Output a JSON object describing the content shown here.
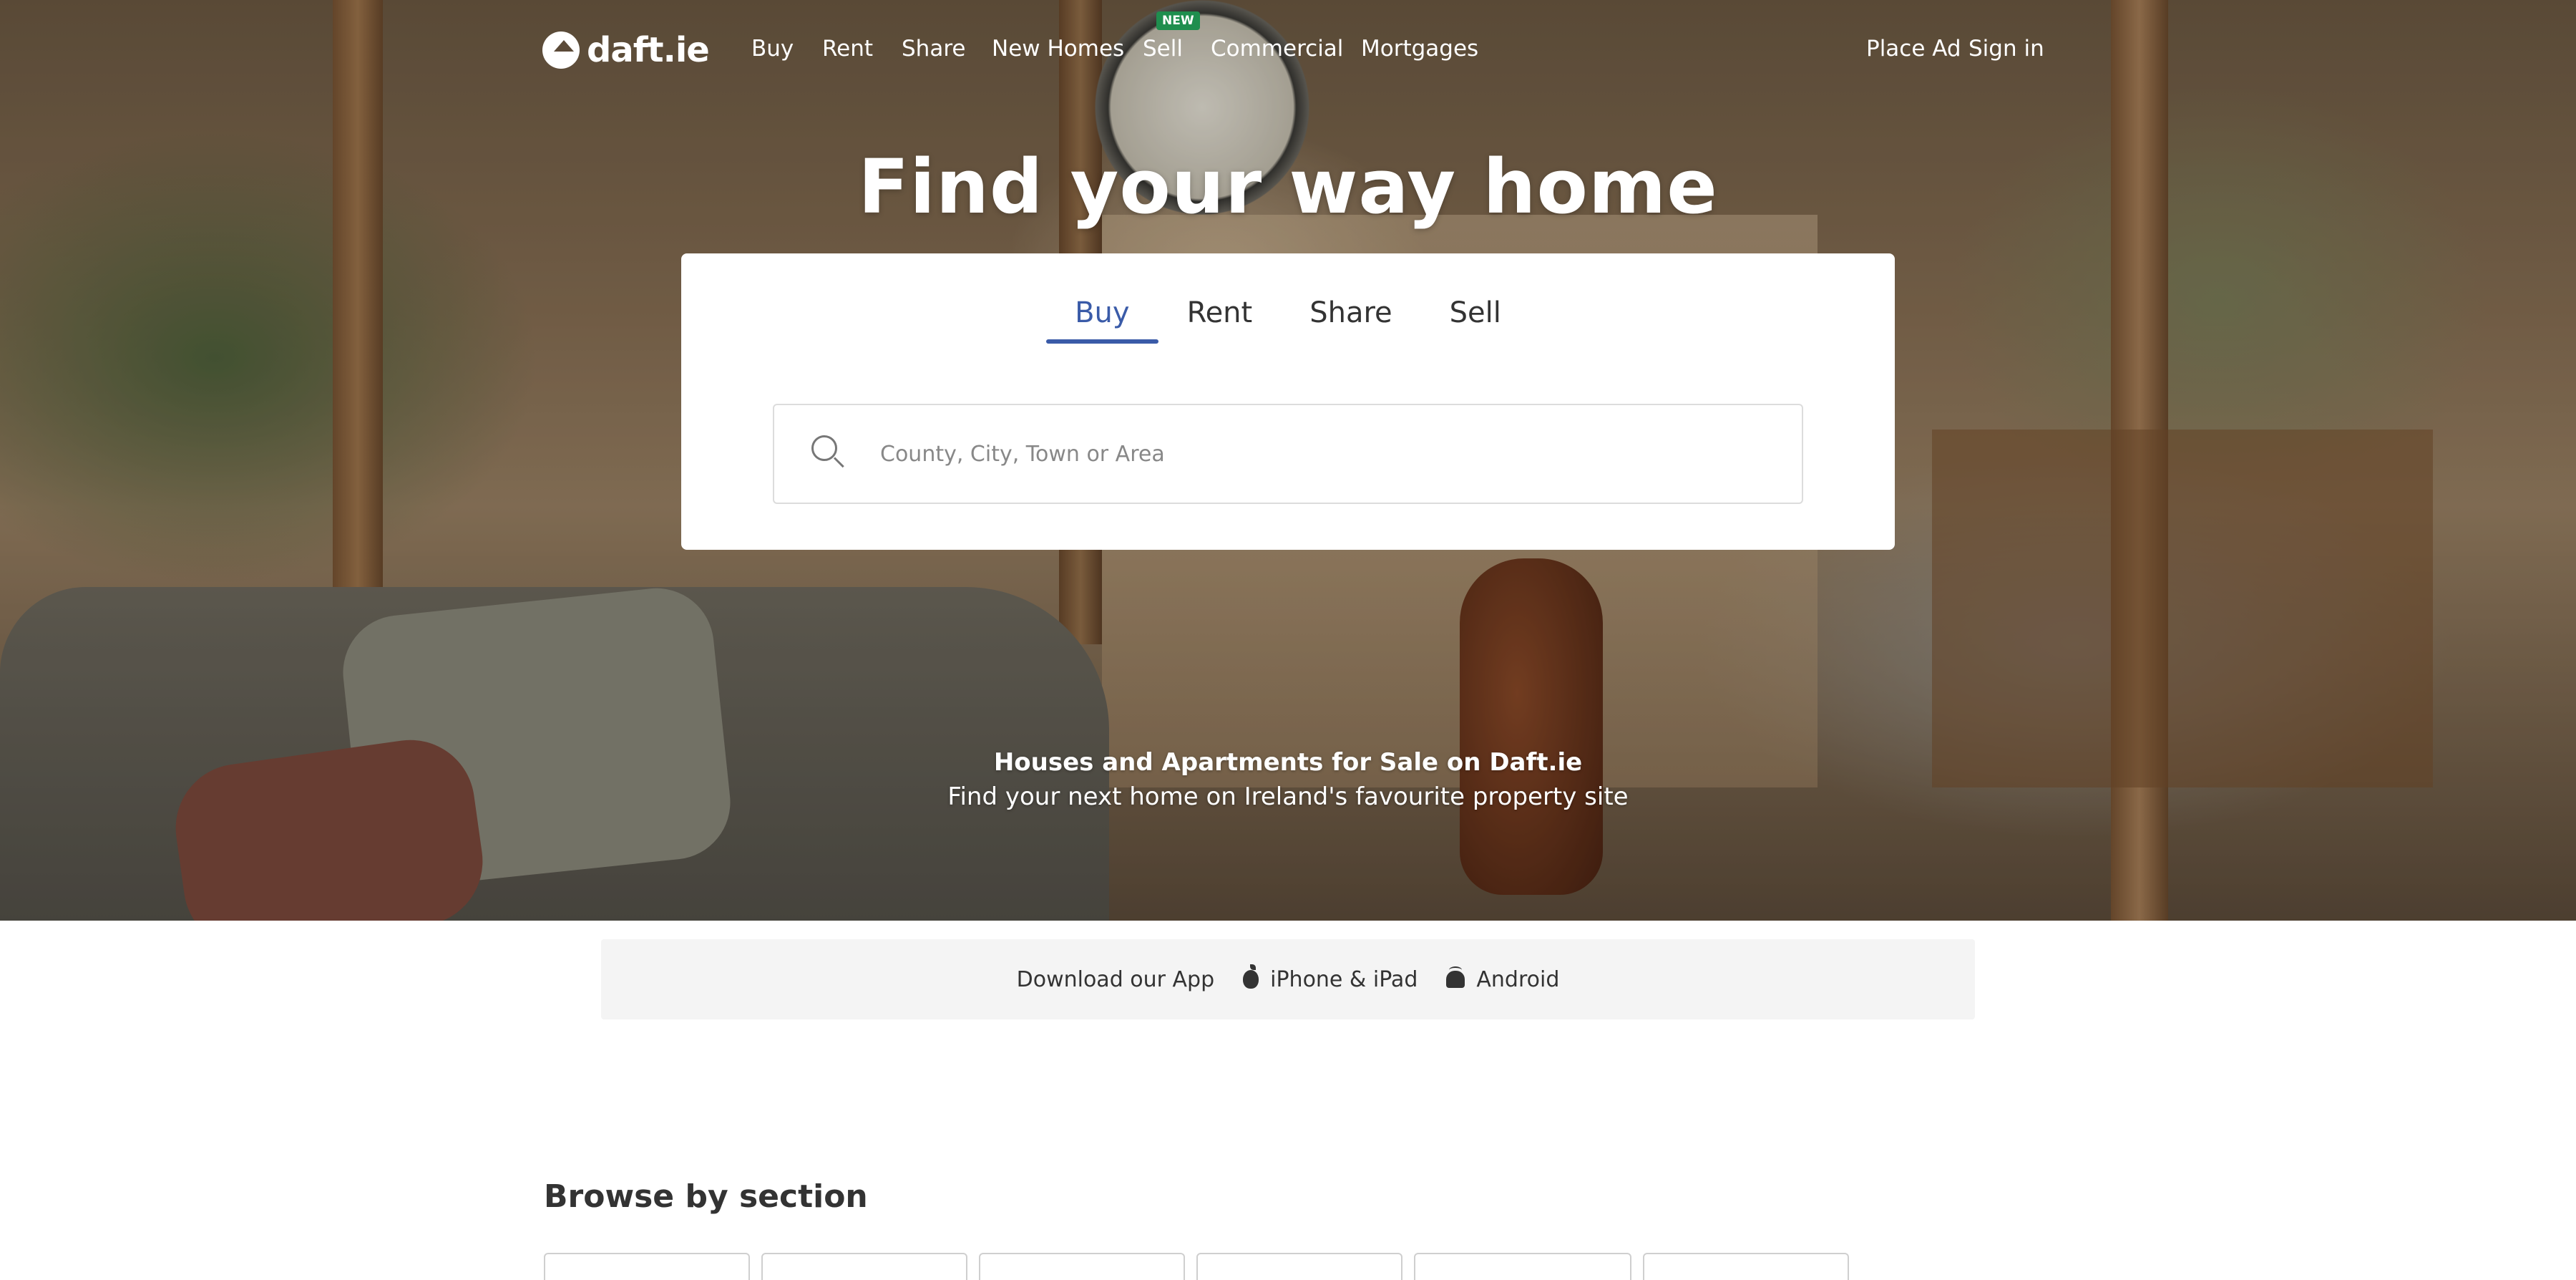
{
  "nav": {
    "logo_text": "daft.ie",
    "items": [
      {
        "label": "Buy"
      },
      {
        "label": "Rent"
      },
      {
        "label": "Share"
      },
      {
        "label": "New Homes"
      },
      {
        "label": "Sell",
        "badge": "NEW"
      },
      {
        "label": "Commercial"
      },
      {
        "label": "Mortgages"
      }
    ],
    "place_ad": "Place Ad",
    "sign_in": "Sign in"
  },
  "hero": {
    "headline": "Find your way home",
    "subtitle_bold": "Houses and Apartments for Sale on Daft.ie",
    "subtitle": "Find your next home on Ireland's favourite property site"
  },
  "search": {
    "tabs": [
      "Buy",
      "Rent",
      "Share",
      "Sell"
    ],
    "active_tab": "Buy",
    "placeholder": "County, City, Town or Area",
    "value": ""
  },
  "app_bar": {
    "text": "Download our App",
    "ios_label": "iPhone & iPad",
    "android_label": "Android"
  },
  "browse": {
    "title": "Browse by section"
  },
  "colors": {
    "accent": "#3a5ba8",
    "badge_new": "#1f8e4e",
    "app_bar_bg": "#f4f4f4"
  }
}
